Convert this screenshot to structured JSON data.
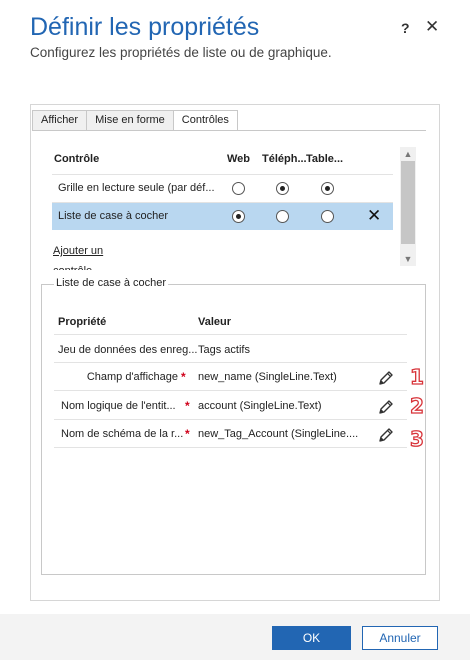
{
  "dialog": {
    "title": "Définir les propriétés",
    "subtitle": "Configurez les propriétés de liste ou de graphique.",
    "help_icon": "?",
    "close_icon": "✕"
  },
  "tabs": [
    {
      "label": "Afficher",
      "active": false
    },
    {
      "label": "Mise en forme",
      "active": false
    },
    {
      "label": "Contrôles",
      "active": true
    }
  ],
  "controls_grid": {
    "headers": {
      "control": "Contrôle",
      "web": "Web",
      "phone": "Téléph...",
      "tablet": "Table..."
    },
    "rows": [
      {
        "label": "Grille en lecture seule (par déf...",
        "web": false,
        "phone": true,
        "tablet": true,
        "selected": false
      },
      {
        "label": "Liste de case à cocher",
        "web": true,
        "phone": false,
        "tablet": false,
        "selected": true
      }
    ],
    "delete_icon": "✕",
    "add_link": "Ajouter un contrôle"
  },
  "properties_section": {
    "legend": "Liste de case à cocher",
    "headers": {
      "property": "Propriété",
      "value": "Valeur"
    },
    "rows": [
      {
        "name": "Jeu de données des enreg...",
        "required": false,
        "value": "Tags actifs",
        "editable": false
      },
      {
        "name": "Champ d'affichage",
        "required": true,
        "value": "new_name (SingleLine.Text)",
        "editable": true,
        "badge": "1"
      },
      {
        "name": "Nom logique de l'entit...",
        "required": true,
        "value": "account (SingleLine.Text)",
        "editable": true,
        "badge": "2"
      },
      {
        "name": "Nom de schéma de la r...",
        "required": true,
        "value": "new_Tag_Account (SingleLine....",
        "editable": true,
        "badge": "3"
      }
    ],
    "required_mark": "*"
  },
  "footer": {
    "ok_label": "OK",
    "cancel_label": "Annuler"
  },
  "colors": {
    "accent": "#2266b3",
    "selected_row": "#b9d7f0",
    "required": "#d0021b",
    "badge": "#d8343a"
  }
}
